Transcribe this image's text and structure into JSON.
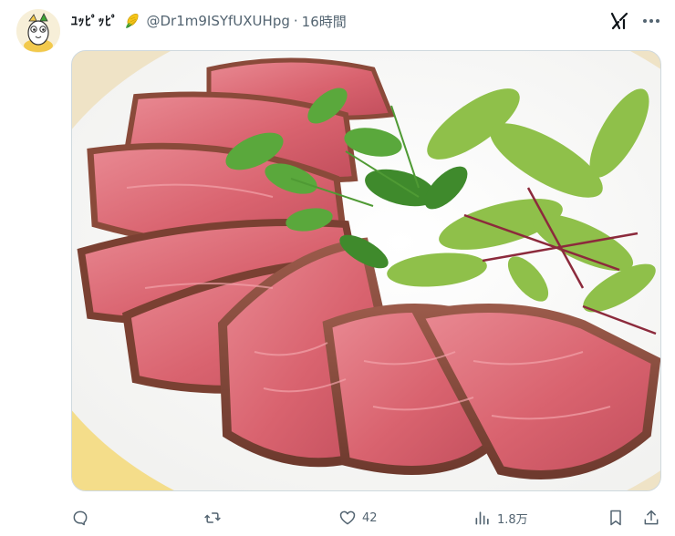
{
  "post": {
    "display_name": "ﾕｯﾋﾟｯﾋﾟ",
    "handle": "@Dr1m9ISYfUXUHpg",
    "separator": "·",
    "time": "16時間"
  },
  "media": {
    "description_icon": "roast-beef-photo"
  },
  "actions": {
    "reply_count": "",
    "repost_count": "",
    "like_count": "42",
    "views_count": "1.8万"
  },
  "colors": {
    "text_secondary": "#536471",
    "border": "#cfd9de",
    "corn_yellow": "#f5c518",
    "corn_green": "#3fa535"
  }
}
